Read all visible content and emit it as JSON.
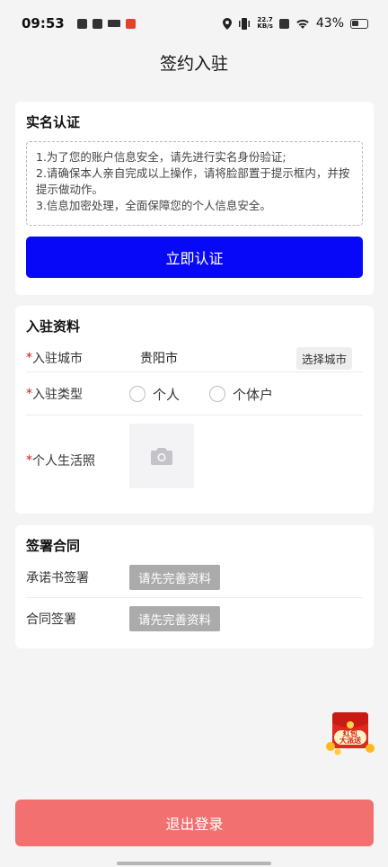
{
  "status_bar": {
    "time": "09:53",
    "net_speed_top": "22.7",
    "net_speed_bottom": "KB/s",
    "battery": "43%"
  },
  "page": {
    "title": "签约入驻"
  },
  "verification": {
    "title": "实名认证",
    "notice_lines": [
      "1.为了您的账户信息安全，请先进行实名身份验证;",
      "2.请确保本人亲自完成以上操作，请将脸部置于提示框内，并按提示做动作。",
      "3.信息加密处理，全面保障您的个人信息安全。"
    ],
    "button_label": "立即认证"
  },
  "info": {
    "title": "入驻资料",
    "required_mark": "*",
    "city_label": "入驻城市",
    "city_value": "贵阳市",
    "city_button": "选择城市",
    "type_label": "入驻类型",
    "type_options": [
      "个人",
      "个体户"
    ],
    "photo_label": "个人生活照"
  },
  "contract": {
    "title": "签署合同",
    "rows": [
      {
        "label": "承诺书签署",
        "button": "请先完善资料"
      },
      {
        "label": "合同签署",
        "button": "请先完善资料"
      }
    ]
  },
  "promo": {
    "line1": "红包",
    "line2": "大派送"
  },
  "logout_label": "退出登录",
  "colors": {
    "primary_blue": "#0808f8",
    "logout_red": "#f27070",
    "required_red": "#c8161d",
    "disabled_gray": "#ababab"
  }
}
